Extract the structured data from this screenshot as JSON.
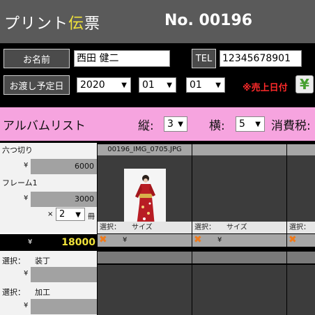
{
  "header": {
    "title_pre": "プリント",
    "title_accent": "伝",
    "title_post": "票",
    "order_no": "No. 00196"
  },
  "customer": {
    "name_label": "お名前",
    "name_value": "西田 健二",
    "tel_label": "TEL",
    "tel_value": "12345678901",
    "date_label": "お渡し予定日",
    "year": "2020",
    "month": "01",
    "day": "01",
    "sales_date_label": "※売上日付",
    "yen_button_icon": "¥"
  },
  "album": {
    "title": "アルバムリスト",
    "rows_label": "縦:",
    "rows_value": "3",
    "cols_label": "横:",
    "cols_value": "5",
    "tax_label": "消費税:"
  },
  "left_panel": {
    "item1_name": "六つ切り",
    "item1_yen": "¥",
    "item1_price": "6000",
    "item2_name": "フレーム1",
    "item2_yen": "¥",
    "item2_price": "3000",
    "qty_x": "×",
    "qty_value": "2",
    "qty_unit": "冊",
    "total_yen": "¥",
    "total_value": "18000",
    "option1_label": "選択：",
    "option1_value": "装丁",
    "option1_yen": "¥",
    "option2_label": "選択：",
    "option2_value": "加工",
    "option2_yen": "¥"
  },
  "photos": [
    {
      "filename": "00196_IMG_0705.JPG",
      "select_label": "選択：",
      "size_label": "サイズ",
      "yen": "¥"
    },
    {
      "filename": "",
      "select_label": "選択：",
      "size_label": "サイズ",
      "yen": "¥"
    },
    {
      "filename": "",
      "select_label": "選択：",
      "size_label": "",
      "yen": ""
    }
  ],
  "colors": {
    "header_bg": "#5a5a5a",
    "accent_yellow": "#f0e23a",
    "album_bar_pink": "#f6a4df",
    "alert_red": "#ff2a2a",
    "remove_orange": "#f07a1a"
  }
}
